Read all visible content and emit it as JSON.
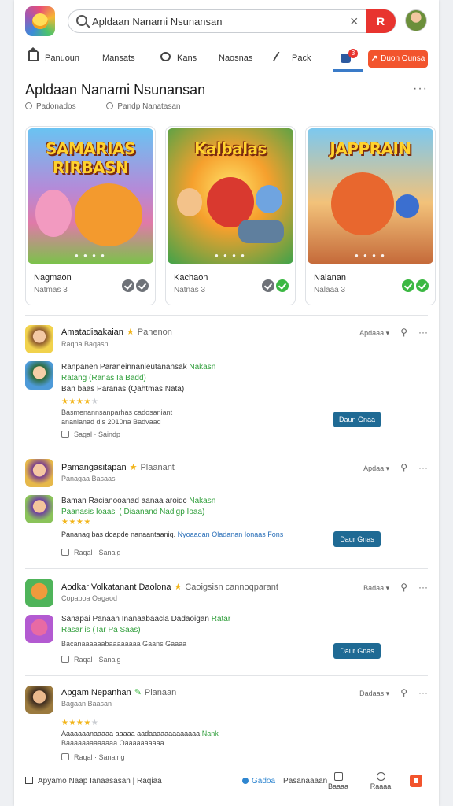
{
  "topbar": {
    "search_value": "Apldaan Nanami Nsunansan",
    "search_go_label": "R"
  },
  "nav": {
    "items": [
      {
        "label": "Panuoun"
      },
      {
        "label": "Mansats"
      },
      {
        "label": "Kans"
      },
      {
        "label": "Naosnas"
      },
      {
        "label": "Pack"
      }
    ],
    "notification_count": "3",
    "cta_label": "Duon Ounsa"
  },
  "header": {
    "title": "Apldaan Nanami Nsunansan",
    "more": "···",
    "meta_1": "Padonados",
    "meta_2": "Pandp Nanatasan"
  },
  "featured": [
    {
      "art_title": "SAMARIAS RIRBASN",
      "name": "Nagmaon",
      "sub": "Natmas  3",
      "check_color": "grey"
    },
    {
      "art_title": "Kalbalas",
      "name": "Kachaon",
      "sub": "Natnas  3",
      "check_color": "green"
    },
    {
      "art_title": "JAPPRAIN",
      "name": "Nalanan",
      "sub": "Nalaaa  3",
      "check_color": "green"
    }
  ],
  "feed": [
    {
      "name": "Amatadiaakaian",
      "tag": "Panenon",
      "sub": "Raqna  Baqasn",
      "right": "Apdaaa",
      "line_1": "Ranpanen Paraneinnanieutanansak",
      "line_1_green": "Nakasn",
      "line_2_green": "Ratang (Ranas Ia Badd)",
      "line_3": "Ban baas Paranas (Qahtmas Nata)",
      "stars": "★★★★",
      "stars_off": "★",
      "line_4": "Basmenannsanparhas cadosaniant",
      "line_5": "ananianad  dis 2010na Badvaad",
      "button": "Daun Gnaa",
      "foot": "Sagal  ·  Saindp"
    },
    {
      "name": "Pamangasitapan",
      "tag": "Plaanant",
      "sub": "Panagaa Basaas",
      "right": "Apdaa",
      "line_1": "Baman Racianooanad aanaa aroidc",
      "line_1_green": "Nakasn",
      "line_2_green": "Paanasis Ioaasi ( Diaanand Nadigp Ioaa)",
      "stars": "★★★★",
      "stars_off": "",
      "line_3": "Pananag  bas  doapde  nanaantaaniq.",
      "line_3_blue": "Nyoaadan Oladanan Ionaas Fons",
      "button": "Daur Gnas",
      "foot": "Raqal  ·  Sanaig"
    },
    {
      "name": "Aodkar Volkatanant Daolona",
      "tag": "Caoigsisn cannoqparant",
      "sub": "Copapoa Oagaod",
      "right": "Badaa",
      "line_1": "Sanapai Panaan Inanaabaacla Dadaoigan",
      "line_1_green": "Ratar",
      "line_2_green": "Rasar is (Tar Pa Saas)",
      "line_3": "Bacanaaaaaabaaaaaaaa Gaans   Gaaaa",
      "button": "Daur Gnas",
      "foot": "Raqal  ·  Sanaig"
    },
    {
      "name": "Apgam Nepanhan",
      "tag": "Planaan",
      "sub": "Bagaan  Baasan",
      "right": "Dadaas",
      "stars": "★★★★",
      "stars_off": "★",
      "line_1": "Aaaaaaanaaaaa aaaaa aadaaaaaaaaaaaaa",
      "line_1_green": "Nank",
      "line_2": "Baaaaaaaaaaaaa  Oaaaaaaaaaa",
      "foot": "Raqal  ·  Sanaing"
    }
  ],
  "bottombar": {
    "left": "Apyamo Naap Ianaasasan  | Raqiaa",
    "mid_active": "Gadoa",
    "mid_other": "Pasanaaaan",
    "icon_1": "Baaaa",
    "icon_2": "Raaaa"
  },
  "colors": {
    "accent_red": "#e8342f",
    "cta_orange": "#f2542d",
    "button_blue": "#1f6a94",
    "active_tab": "#3a7bc8",
    "green": "#3cb843"
  }
}
